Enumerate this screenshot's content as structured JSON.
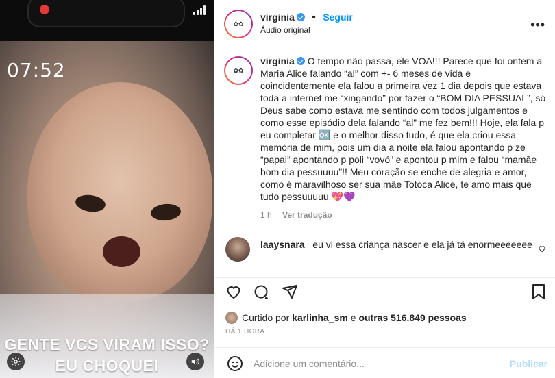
{
  "media": {
    "time_overlay": "07:52",
    "caption_line1": "GENTE VCS VIRAM ISSO?",
    "caption_line2": "EU CHOQUEI",
    "icons": [
      "record-indicator",
      "signal-icon",
      "gear-icon",
      "speaker-icon"
    ]
  },
  "header": {
    "username": "virginia",
    "follow_label": "Seguir",
    "audio_label": "Áudio original",
    "more_icon": "more-options-icon"
  },
  "post": {
    "username": "virginia",
    "caption": "O tempo não passa, ele VOA!!! Parece que foi ontem a Maria Alice falando “al” com +- 6 meses de vida e coincidentemente ela falou a primeira vez 1 dia depois que estava toda a internet me “xingando” por fazer o “BOM DIA PESSUAL”, só Deus sabe como estava me sentindo com todos julgamentos e como esse episódio dela falando “al” me fez bem!!! Hoje, ela fala p eu completar 🆗 e o melhor disso tudo, é que ela criou essa memória de mim, pois um dia a noite ela falou apontando p ze “papai” apontando p poli “vovó” e apontou p mim e falou “mamãe bom dia pessuuuu”!! Meu coração se enche de alegria e amor, como é maravilhoso ser sua mãe Totoca Alice, te amo mais que tudo pessuuuuu 💖💜",
    "time": "1 h",
    "translate_label": "Ver tradução"
  },
  "comment": {
    "username": "laaysnara_",
    "text": "eu vi essa criança nascer e ela já tá enormeeeeeee"
  },
  "likes": {
    "prefix": "Curtido por",
    "user": "karlinha_sm",
    "middle": "e",
    "others": "outras 516.849 pessoas"
  },
  "time_ago": "HÁ 1 HORA",
  "add_comment": {
    "placeholder": "Adicione um comentário...",
    "publish_label": "Publicar"
  },
  "colors": {
    "follow": "#0095f6",
    "verified": "#3897f0",
    "publish_disabled": "#b2dffc",
    "muted_text": "#8e8e8e"
  }
}
